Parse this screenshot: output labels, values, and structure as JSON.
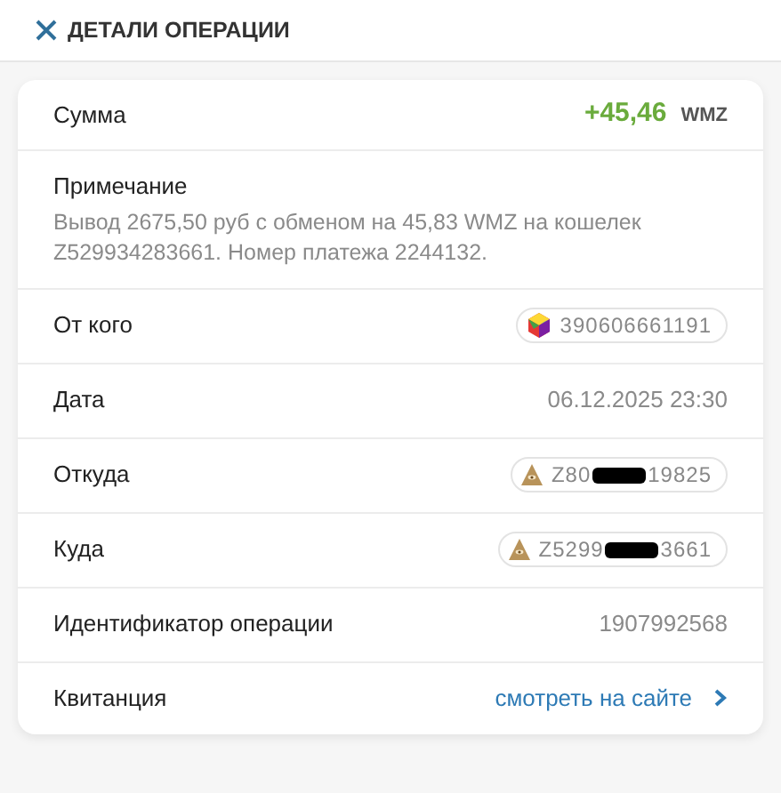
{
  "header": {
    "title": "ДЕТАЛИ ОПЕРАЦИИ"
  },
  "rows": [
    {
      "kind": "amount",
      "label": "Сумма",
      "value": "+45,46",
      "unit": "WMZ"
    },
    {
      "kind": "note",
      "label": "Примечание",
      "text": "Вывод 2675,50 руб с обменом на 45,83 WMZ на кошелек Z529934283661. Номер платежа 2244132."
    },
    {
      "kind": "wmid",
      "label": "От кого",
      "prefix": "390606661191",
      "redacted": false
    },
    {
      "kind": "text",
      "label": "Дата",
      "value": "06.12.2025 23:30"
    },
    {
      "kind": "purse",
      "label": "Откуда",
      "prefix": "Z80",
      "suffix": "19825",
      "redacted": true
    },
    {
      "kind": "purse",
      "label": "Куда",
      "prefix": "Z5299",
      "suffix": "3661",
      "redacted": true
    },
    {
      "kind": "text",
      "label": "Идентификатор операции",
      "value": "1907992568"
    },
    {
      "kind": "link",
      "label": "Квитанция",
      "value": "смотреть на сайте"
    }
  ]
}
